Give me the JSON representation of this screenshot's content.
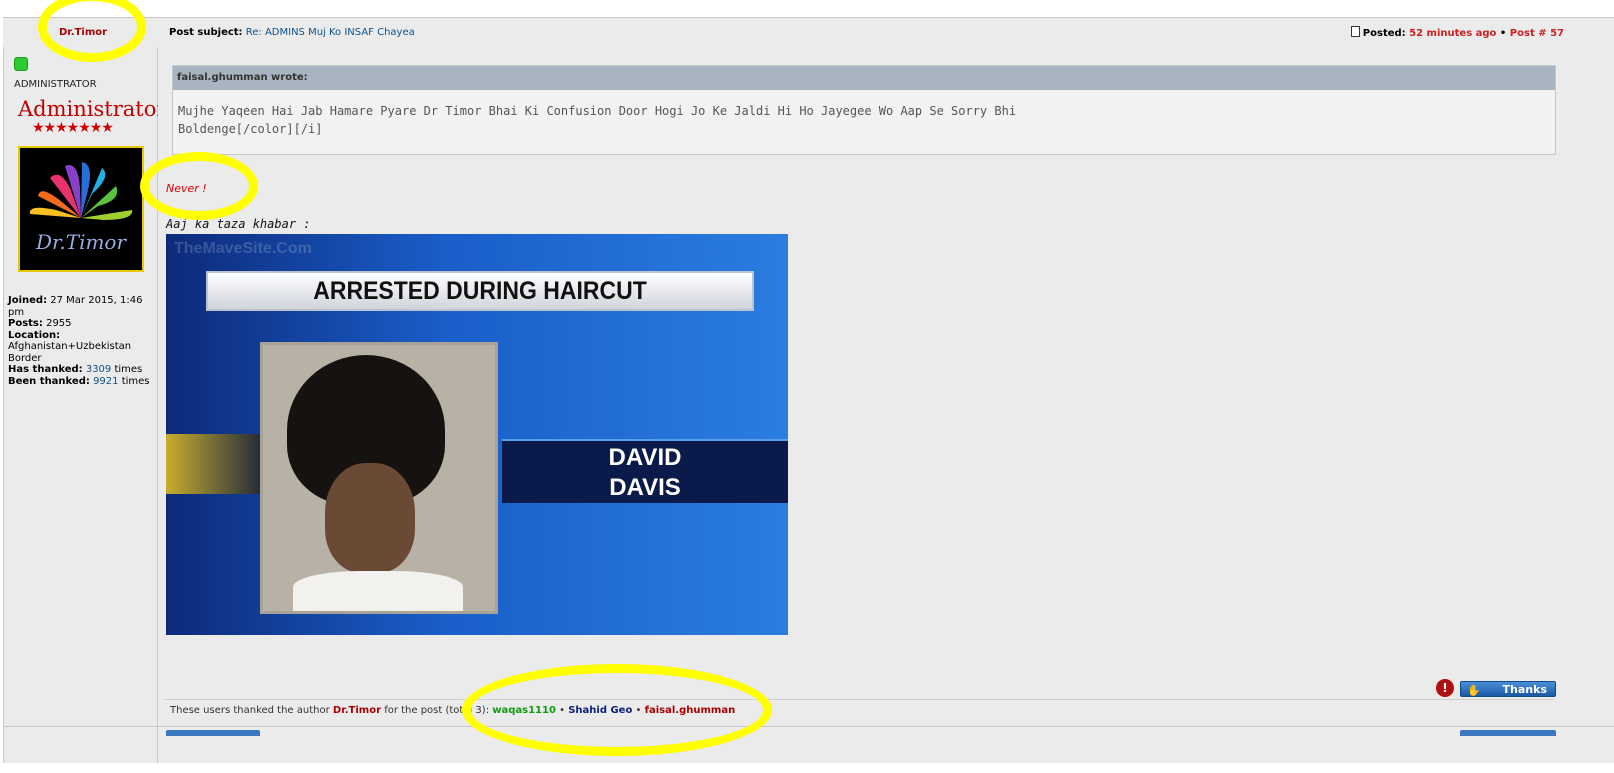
{
  "header": {
    "author": "Dr.Timor",
    "post_subject_label": "Post subject:",
    "post_subject_value": "Re: ADMINS Muj Ko INSAF Chayea",
    "posted_label": "Posted:",
    "posted_value": "52 minutes ago",
    "post_number": "Post # 57"
  },
  "profile": {
    "rank_text": "ADMINISTRATOR",
    "rank_title": "Administrator",
    "rank_stars": "★★★★★★★",
    "avatar_text": "Dr.Timor",
    "joined_label": "Joined:",
    "joined_value": "27 Mar 2015, 1:46 pm",
    "posts_label": "Posts:",
    "posts_value": "2955",
    "location_label": "Location:",
    "location_value": "Afghanistan+Uzbekistan Border",
    "has_thanked_label": "Has thanked:",
    "has_thanked_value": "3309",
    "has_thanked_suffix": "times",
    "been_thanked_label": "Been thanked:",
    "been_thanked_value": "9921",
    "been_thanked_suffix": "times"
  },
  "quote": {
    "author_line": "faisal.ghumman wrote:",
    "line1": "Mujhe Yaqeen Hai Jab Hamare Pyare Dr Timor Bhai Ki Confusion Door Hogi Jo Ke Jaldi Hi Ho Jayegee Wo Aap Se Sorry Bhi",
    "line2": "Boldenge[/color][/i]"
  },
  "post": {
    "never_text": "Never !",
    "caption": "Aaj ka taza khabar :",
    "image": {
      "watermark": "TheMaveSite.Com",
      "headline": "ARRESTED DURING HAIRCUT",
      "name_line1": "DAVID",
      "name_line2": "DAVIS"
    }
  },
  "footer": {
    "warn_symbol": "!",
    "thanks_label": "Thanks",
    "thanked_prefix": "These users thanked the author",
    "thanked_author": "Dr.Timor",
    "thanked_suffix": "for the post (total 3):",
    "users": [
      "waqas1110",
      "Shahid Geo",
      "faisal.ghumman"
    ],
    "separator": "•"
  },
  "colors": {
    "author_red": "#aa0000",
    "link_blue": "#105289",
    "highlight": "#ffff00"
  }
}
